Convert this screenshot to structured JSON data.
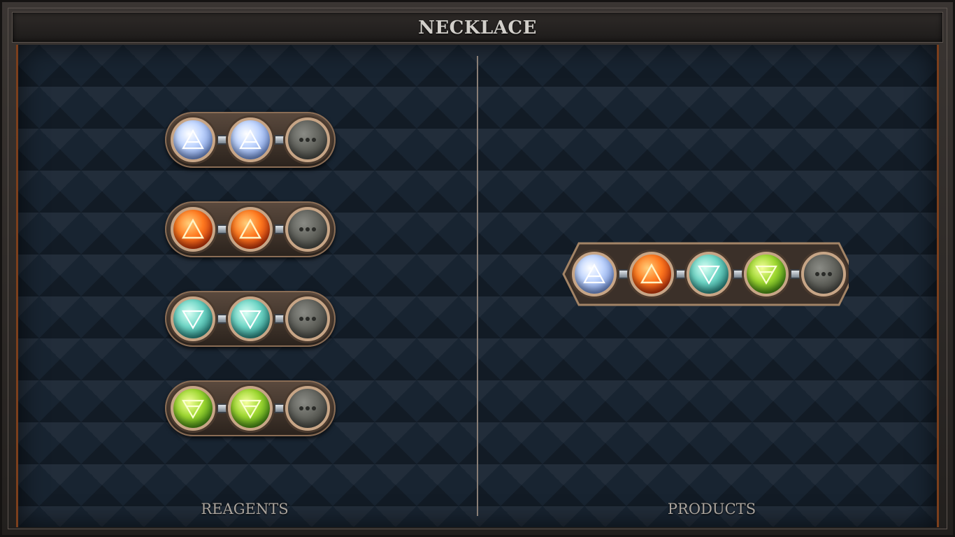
{
  "title": "NECKLACE",
  "reagents_label": "REAGENTS",
  "products_label": "PRODUCTS",
  "reagents": [
    {
      "gems": [
        "air",
        "air",
        "empty"
      ]
    },
    {
      "gems": [
        "fire",
        "fire",
        "empty"
      ]
    },
    {
      "gems": [
        "water",
        "water",
        "empty"
      ]
    },
    {
      "gems": [
        "earth",
        "earth",
        "empty"
      ]
    }
  ],
  "products": [
    {
      "gems": [
        "air",
        "fire",
        "water",
        "earth",
        "empty"
      ]
    }
  ],
  "colors": {
    "air": "#c4d8ff",
    "fire": "#ff7a20",
    "water": "#6fd6c6",
    "earth": "#9fd832",
    "empty": "#5e5f59",
    "border_accent": "#7c3f1c"
  },
  "icons": {
    "air": "air-triangle-icon",
    "fire": "fire-triangle-icon",
    "water": "water-triangle-icon",
    "earth": "earth-triangle-icon",
    "empty": "ellipsis-icon"
  }
}
